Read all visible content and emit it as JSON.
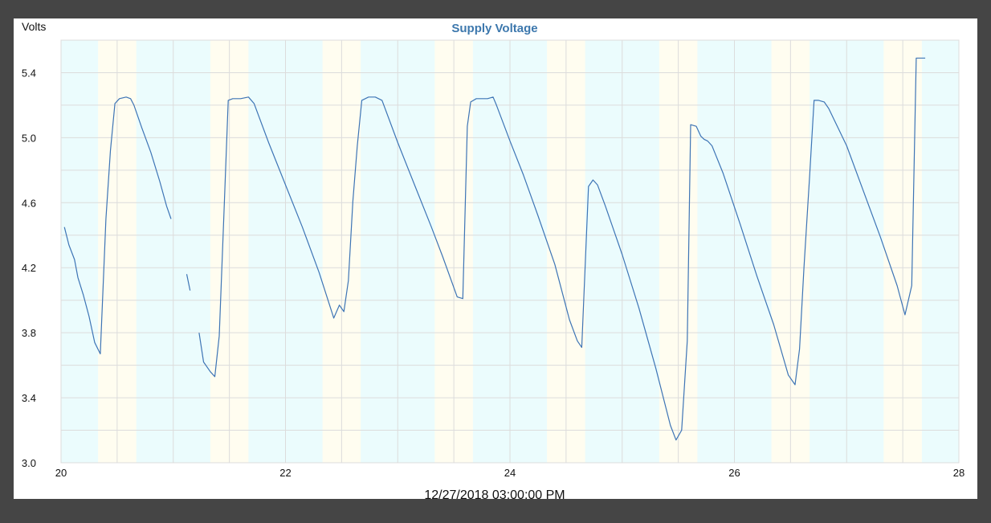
{
  "colors": {
    "background": "#454545",
    "panel": "#ffffff",
    "line": "#3d74b5",
    "title": "#3d78ad",
    "band_day": "#fffdf0",
    "band_night": "#ebfcfd",
    "grid": "#dcdcdc"
  },
  "chart_data": {
    "type": "line",
    "title": "Supply Voltage",
    "ylabel": "Volts",
    "xlabel": "12/27/2018 03:00:00 PM",
    "xlim": [
      20,
      28
    ],
    "ylim": [
      3.0,
      5.6
    ],
    "xticks": [
      20,
      22,
      24,
      26,
      28
    ],
    "yticks": [
      3.0,
      3.4,
      3.8,
      4.2,
      4.6,
      5.0,
      5.4
    ],
    "grid": true,
    "day_bands": [
      [
        20.33,
        20.67
      ],
      [
        21.33,
        21.67
      ],
      [
        22.33,
        22.67
      ],
      [
        23.33,
        23.67
      ],
      [
        24.33,
        24.67
      ],
      [
        25.33,
        25.67
      ],
      [
        26.33,
        26.67
      ],
      [
        27.33,
        27.67
      ]
    ],
    "series": [
      {
        "segments": [
          [
            [
              20.03,
              4.45
            ],
            [
              20.07,
              4.34
            ],
            [
              20.12,
              4.25
            ],
            [
              20.15,
              4.14
            ],
            [
              20.2,
              4.03
            ],
            [
              20.25,
              3.9
            ],
            [
              20.3,
              3.74
            ],
            [
              20.35,
              3.67
            ],
            [
              20.4,
              4.5
            ],
            [
              20.44,
              4.92
            ],
            [
              20.48,
              5.21
            ],
            [
              20.52,
              5.24
            ],
            [
              20.58,
              5.25
            ],
            [
              20.62,
              5.24
            ],
            [
              20.65,
              5.2
            ],
            [
              20.72,
              5.06
            ],
            [
              20.8,
              4.91
            ],
            [
              20.88,
              4.73
            ],
            [
              20.94,
              4.58
            ],
            [
              20.98,
              4.5
            ]
          ],
          [
            [
              21.12,
              4.16
            ],
            [
              21.15,
              4.06
            ]
          ],
          [
            [
              21.23,
              3.8
            ],
            [
              21.27,
              3.62
            ],
            [
              21.33,
              3.56
            ],
            [
              21.37,
              3.53
            ],
            [
              21.41,
              3.78
            ],
            [
              21.45,
              4.5
            ],
            [
              21.49,
              5.23
            ],
            [
              21.53,
              5.24
            ],
            [
              21.6,
              5.24
            ],
            [
              21.67,
              5.25
            ],
            [
              21.72,
              5.21
            ],
            [
              21.85,
              4.97
            ],
            [
              22.0,
              4.71
            ],
            [
              22.15,
              4.45
            ],
            [
              22.3,
              4.17
            ],
            [
              22.43,
              3.89
            ],
            [
              22.48,
              3.97
            ],
            [
              22.52,
              3.93
            ],
            [
              22.56,
              4.12
            ],
            [
              22.6,
              4.61
            ],
            [
              22.64,
              4.95
            ],
            [
              22.68,
              5.23
            ],
            [
              22.74,
              5.25
            ],
            [
              22.8,
              5.25
            ],
            [
              22.86,
              5.23
            ],
            [
              23.0,
              4.97
            ],
            [
              23.15,
              4.71
            ],
            [
              23.3,
              4.45
            ],
            [
              23.4,
              4.27
            ],
            [
              23.53,
              4.02
            ],
            [
              23.58,
              4.01
            ],
            [
              23.62,
              5.07
            ],
            [
              23.65,
              5.22
            ],
            [
              23.7,
              5.24
            ],
            [
              23.8,
              5.24
            ],
            [
              23.85,
              5.25
            ],
            [
              23.88,
              5.2
            ],
            [
              24.0,
              4.98
            ],
            [
              24.12,
              4.77
            ],
            [
              24.25,
              4.52
            ],
            [
              24.4,
              4.22
            ],
            [
              24.53,
              3.88
            ],
            [
              24.6,
              3.75
            ],
            [
              24.64,
              3.71
            ],
            [
              24.7,
              4.7
            ],
            [
              24.74,
              4.74
            ],
            [
              24.78,
              4.71
            ],
            [
              24.85,
              4.58
            ],
            [
              25.0,
              4.28
            ],
            [
              25.15,
              3.95
            ],
            [
              25.3,
              3.58
            ],
            [
              25.43,
              3.23
            ],
            [
              25.48,
              3.14
            ],
            [
              25.53,
              3.2
            ],
            [
              25.58,
              3.75
            ],
            [
              25.61,
              5.08
            ],
            [
              25.66,
              5.07
            ],
            [
              25.7,
              5.01
            ],
            [
              25.73,
              4.99
            ],
            [
              25.76,
              4.98
            ],
            [
              25.8,
              4.95
            ],
            [
              25.9,
              4.78
            ],
            [
              26.05,
              4.47
            ],
            [
              26.2,
              4.15
            ],
            [
              26.35,
              3.85
            ],
            [
              26.48,
              3.54
            ],
            [
              26.54,
              3.48
            ],
            [
              26.58,
              3.7
            ],
            [
              26.62,
              4.2
            ],
            [
              26.67,
              4.76
            ],
            [
              26.71,
              5.23
            ],
            [
              26.75,
              5.23
            ],
            [
              26.8,
              5.22
            ],
            [
              26.84,
              5.18
            ],
            [
              27.0,
              4.95
            ],
            [
              27.15,
              4.67
            ],
            [
              27.3,
              4.39
            ],
            [
              27.45,
              4.09
            ],
            [
              27.52,
              3.91
            ],
            [
              27.58,
              4.09
            ],
            [
              27.62,
              5.49
            ],
            [
              27.7,
              5.49
            ]
          ]
        ]
      }
    ]
  }
}
